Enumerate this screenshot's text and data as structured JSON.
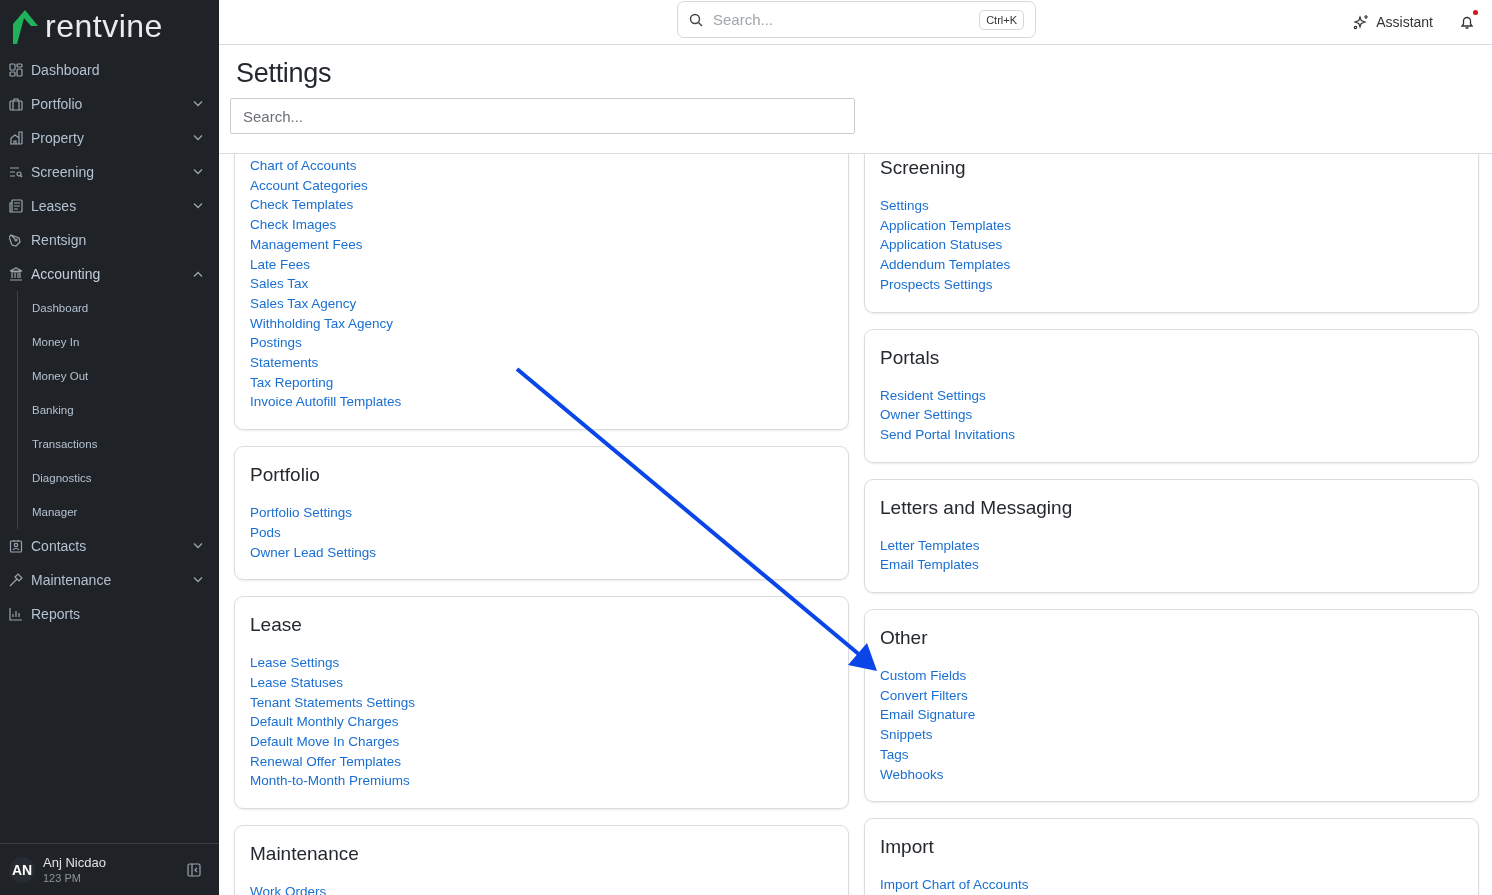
{
  "brand": {
    "name": "rentvine"
  },
  "nav": [
    {
      "label": "Dashboard",
      "kind": "dashboard",
      "expandable": false,
      "expanded": false
    },
    {
      "label": "Portfolio",
      "kind": "portfolio",
      "expandable": true,
      "expanded": false
    },
    {
      "label": "Property",
      "kind": "property",
      "expandable": true,
      "expanded": false
    },
    {
      "label": "Screening",
      "kind": "screening",
      "expandable": true,
      "expanded": false
    },
    {
      "label": "Leases",
      "kind": "leases",
      "expandable": true,
      "expanded": false
    },
    {
      "label": "Rentsign",
      "kind": "rentsign",
      "expandable": false,
      "expanded": false
    },
    {
      "label": "Accounting",
      "kind": "accounting",
      "expandable": true,
      "expanded": true,
      "children": [
        {
          "label": "Dashboard"
        },
        {
          "label": "Money In"
        },
        {
          "label": "Money Out"
        },
        {
          "label": "Banking"
        },
        {
          "label": "Transactions"
        },
        {
          "label": "Diagnostics"
        },
        {
          "label": "Manager"
        }
      ]
    },
    {
      "label": "Contacts",
      "kind": "contacts",
      "expandable": true,
      "expanded": false
    },
    {
      "label": "Maintenance",
      "kind": "maintenance",
      "expandable": true,
      "expanded": false
    },
    {
      "label": "Reports",
      "kind": "reports",
      "expandable": false,
      "expanded": false
    }
  ],
  "user": {
    "initials": "AN",
    "name": "Anj Nicdao",
    "subtitle": "123 PM"
  },
  "topbar": {
    "search": {
      "placeholder": "Search..."
    },
    "shortcut": "Ctrl+K",
    "assistant": "Assistant",
    "notifications_unread": true
  },
  "page": {
    "title": "Settings",
    "search": {
      "placeholder": "Search..."
    }
  },
  "columns": [
    [
      {
        "links": [
          "Chart of Accounts",
          "Account Categories",
          "Check Templates",
          "Check Images",
          "Management Fees",
          "Late Fees",
          "Sales Tax",
          "Sales Tax Agency",
          "Withholding Tax Agency",
          "Postings",
          "Statements",
          "Tax Reporting",
          "Invoice Autofill Templates"
        ]
      },
      {
        "title": "Portfolio",
        "links": [
          "Portfolio Settings",
          "Pods",
          "Owner Lead Settings"
        ]
      },
      {
        "title": "Lease",
        "links": [
          "Lease Settings",
          "Lease Statuses",
          "Tenant Statements Settings",
          "Default Monthly Charges",
          "Default Move In Charges",
          "Renewal Offer Templates",
          "Month-to-Month Premiums"
        ]
      },
      {
        "title": "Maintenance",
        "links": [
          "Work Orders"
        ]
      }
    ],
    [
      {
        "title": "Screening",
        "links": [
          "Settings",
          "Application Templates",
          "Application Statuses",
          "Addendum Templates",
          "Prospects Settings"
        ]
      },
      {
        "title": "Portals",
        "links": [
          "Resident Settings",
          "Owner Settings",
          "Send Portal Invitations"
        ]
      },
      {
        "title": "Letters and Messaging",
        "links": [
          "Letter Templates",
          "Email Templates"
        ]
      },
      {
        "title": "Other",
        "links": [
          "Custom Fields",
          "Convert Filters",
          "Email Signature",
          "Snippets",
          "Tags",
          "Webhooks"
        ]
      },
      {
        "title": "Import",
        "links": [
          "Import Chart of Accounts"
        ]
      }
    ]
  ]
}
